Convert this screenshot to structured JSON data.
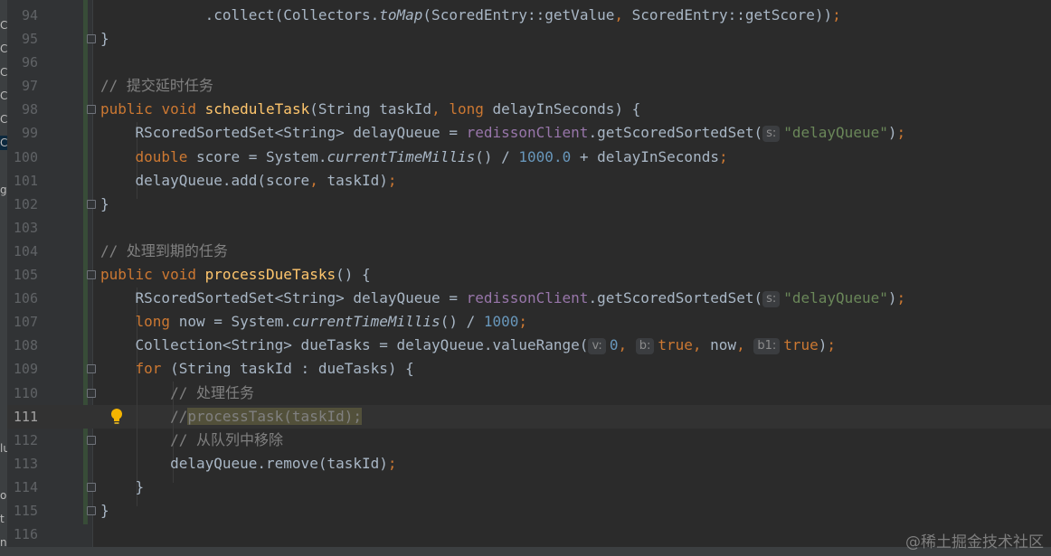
{
  "left_strip": {
    "glyphs": [
      {
        "text": "C",
        "row": 1
      },
      {
        "text": "C",
        "row": 2
      },
      {
        "text": "C",
        "row": 3
      },
      {
        "text": "C",
        "row": 4
      },
      {
        "text": "C",
        "row": 5
      },
      {
        "text": "C",
        "row": 6
      },
      {
        "text": "g",
        "row": 8
      },
      {
        "text": "lu",
        "row": 19
      },
      {
        "text": "o.",
        "row": 21
      },
      {
        "text": "t",
        "row": 22
      },
      {
        "text": "n",
        "row": 23
      }
    ]
  },
  "editor": {
    "current_line": 111,
    "lines": [
      {
        "num": "94",
        "tokens": [
          {
            "t": "            .collect(Collectors."
          },
          {
            "t": "toMap",
            "c": "it"
          },
          {
            "t": "(ScoredEntry::getValue"
          },
          {
            "t": ",",
            "c": "kw"
          },
          {
            "t": " ScoredEntry::getScore))"
          },
          {
            "t": ";",
            "c": "kw"
          }
        ]
      },
      {
        "num": "95",
        "fold": true,
        "tokens": [
          {
            "t": "}"
          }
        ]
      },
      {
        "num": "96",
        "tokens": []
      },
      {
        "num": "97",
        "tokens": [
          {
            "t": "// 提交延时任务",
            "c": "cm"
          }
        ]
      },
      {
        "num": "98",
        "fold": true,
        "tokens": [
          {
            "t": "public ",
            "c": "kw"
          },
          {
            "t": "void ",
            "c": "kw"
          },
          {
            "t": "scheduleTask",
            "c": "fn"
          },
          {
            "t": "(String taskId"
          },
          {
            "t": ", ",
            "c": "kw"
          },
          {
            "t": "long ",
            "c": "kw"
          },
          {
            "t": "delayInSeconds) {"
          }
        ]
      },
      {
        "num": "99",
        "tokens": [
          {
            "t": "    RScoredSortedSet<String> delayQueue = "
          },
          {
            "t": "redissonClient",
            "c": "fld"
          },
          {
            "t": ".getScoredSortedSet("
          },
          {
            "h": "s:"
          },
          {
            "t": "\"delayQueue\"",
            "c": "st"
          },
          {
            "t": ")"
          },
          {
            "t": ";",
            "c": "kw"
          }
        ]
      },
      {
        "num": "100",
        "tokens": [
          {
            "t": "    "
          },
          {
            "t": "double ",
            "c": "kw"
          },
          {
            "t": "score = System."
          },
          {
            "t": "currentTimeMillis",
            "c": "it"
          },
          {
            "t": "() / "
          },
          {
            "t": "1000.0",
            "c": "nm"
          },
          {
            "t": " + delayInSeconds"
          },
          {
            "t": ";",
            "c": "kw"
          }
        ]
      },
      {
        "num": "101",
        "tokens": [
          {
            "t": "    delayQueue.add(score"
          },
          {
            "t": ", ",
            "c": "kw"
          },
          {
            "t": "taskId)"
          },
          {
            "t": ";",
            "c": "kw"
          }
        ]
      },
      {
        "num": "102",
        "fold": true,
        "tokens": [
          {
            "t": "}"
          }
        ]
      },
      {
        "num": "103",
        "tokens": []
      },
      {
        "num": "104",
        "tokens": [
          {
            "t": "// 处理到期的任务",
            "c": "cm"
          }
        ]
      },
      {
        "num": "105",
        "fold": true,
        "tokens": [
          {
            "t": "public ",
            "c": "kw"
          },
          {
            "t": "void ",
            "c": "kw"
          },
          {
            "t": "processDueTasks",
            "c": "fn"
          },
          {
            "t": "() {"
          }
        ]
      },
      {
        "num": "106",
        "tokens": [
          {
            "t": "    RScoredSortedSet<String> delayQueue = "
          },
          {
            "t": "redissonClient",
            "c": "fld"
          },
          {
            "t": ".getScoredSortedSet("
          },
          {
            "h": "s:"
          },
          {
            "t": "\"delayQueue\"",
            "c": "st"
          },
          {
            "t": ")"
          },
          {
            "t": ";",
            "c": "kw"
          }
        ]
      },
      {
        "num": "107",
        "tokens": [
          {
            "t": "    "
          },
          {
            "t": "long ",
            "c": "kw"
          },
          {
            "t": "now = System."
          },
          {
            "t": "currentTimeMillis",
            "c": "it"
          },
          {
            "t": "() / "
          },
          {
            "t": "1000",
            "c": "nm"
          },
          {
            "t": ";",
            "c": "kw"
          }
        ]
      },
      {
        "num": "108",
        "tokens": [
          {
            "t": "    Collection<String> dueTasks = delayQueue.valueRange("
          },
          {
            "h": "v:"
          },
          {
            "t": "0",
            "c": "nm"
          },
          {
            "t": ", ",
            "c": "kw"
          },
          {
            "h": "b:"
          },
          {
            "t": "true",
            "c": "kw"
          },
          {
            "t": ", ",
            "c": "kw"
          },
          {
            "t": "now"
          },
          {
            "t": ", ",
            "c": "kw"
          },
          {
            "h": "b1:"
          },
          {
            "t": "true",
            "c": "kw"
          },
          {
            "t": ")"
          },
          {
            "t": ";",
            "c": "kw"
          }
        ]
      },
      {
        "num": "109",
        "fold": true,
        "tokens": [
          {
            "t": "    "
          },
          {
            "t": "for ",
            "c": "kw"
          },
          {
            "t": "(String taskId : dueTasks) {"
          }
        ]
      },
      {
        "num": "110",
        "fold": true,
        "tokens": [
          {
            "t": "        "
          },
          {
            "t": "// 处理任务",
            "c": "cm"
          }
        ]
      },
      {
        "num": "111",
        "bulb": true,
        "tokens": [
          {
            "t": "        "
          },
          {
            "t": "//",
            "c": "cm"
          },
          {
            "t": "processTask(taskId);",
            "c": "warn-hl"
          }
        ]
      },
      {
        "num": "112",
        "fold": true,
        "tokens": [
          {
            "t": "        "
          },
          {
            "t": "// 从队列中移除",
            "c": "cm"
          }
        ]
      },
      {
        "num": "113",
        "tokens": [
          {
            "t": "        delayQueue.remove(taskId)"
          },
          {
            "t": ";",
            "c": "kw"
          }
        ]
      },
      {
        "num": "114",
        "fold": true,
        "tokens": [
          {
            "t": "    }"
          }
        ]
      },
      {
        "num": "115",
        "fold": true,
        "tokens": [
          {
            "t": "}"
          }
        ]
      },
      {
        "num": "116",
        "tokens": []
      }
    ]
  },
  "watermark": "@稀土掘金技术社区"
}
